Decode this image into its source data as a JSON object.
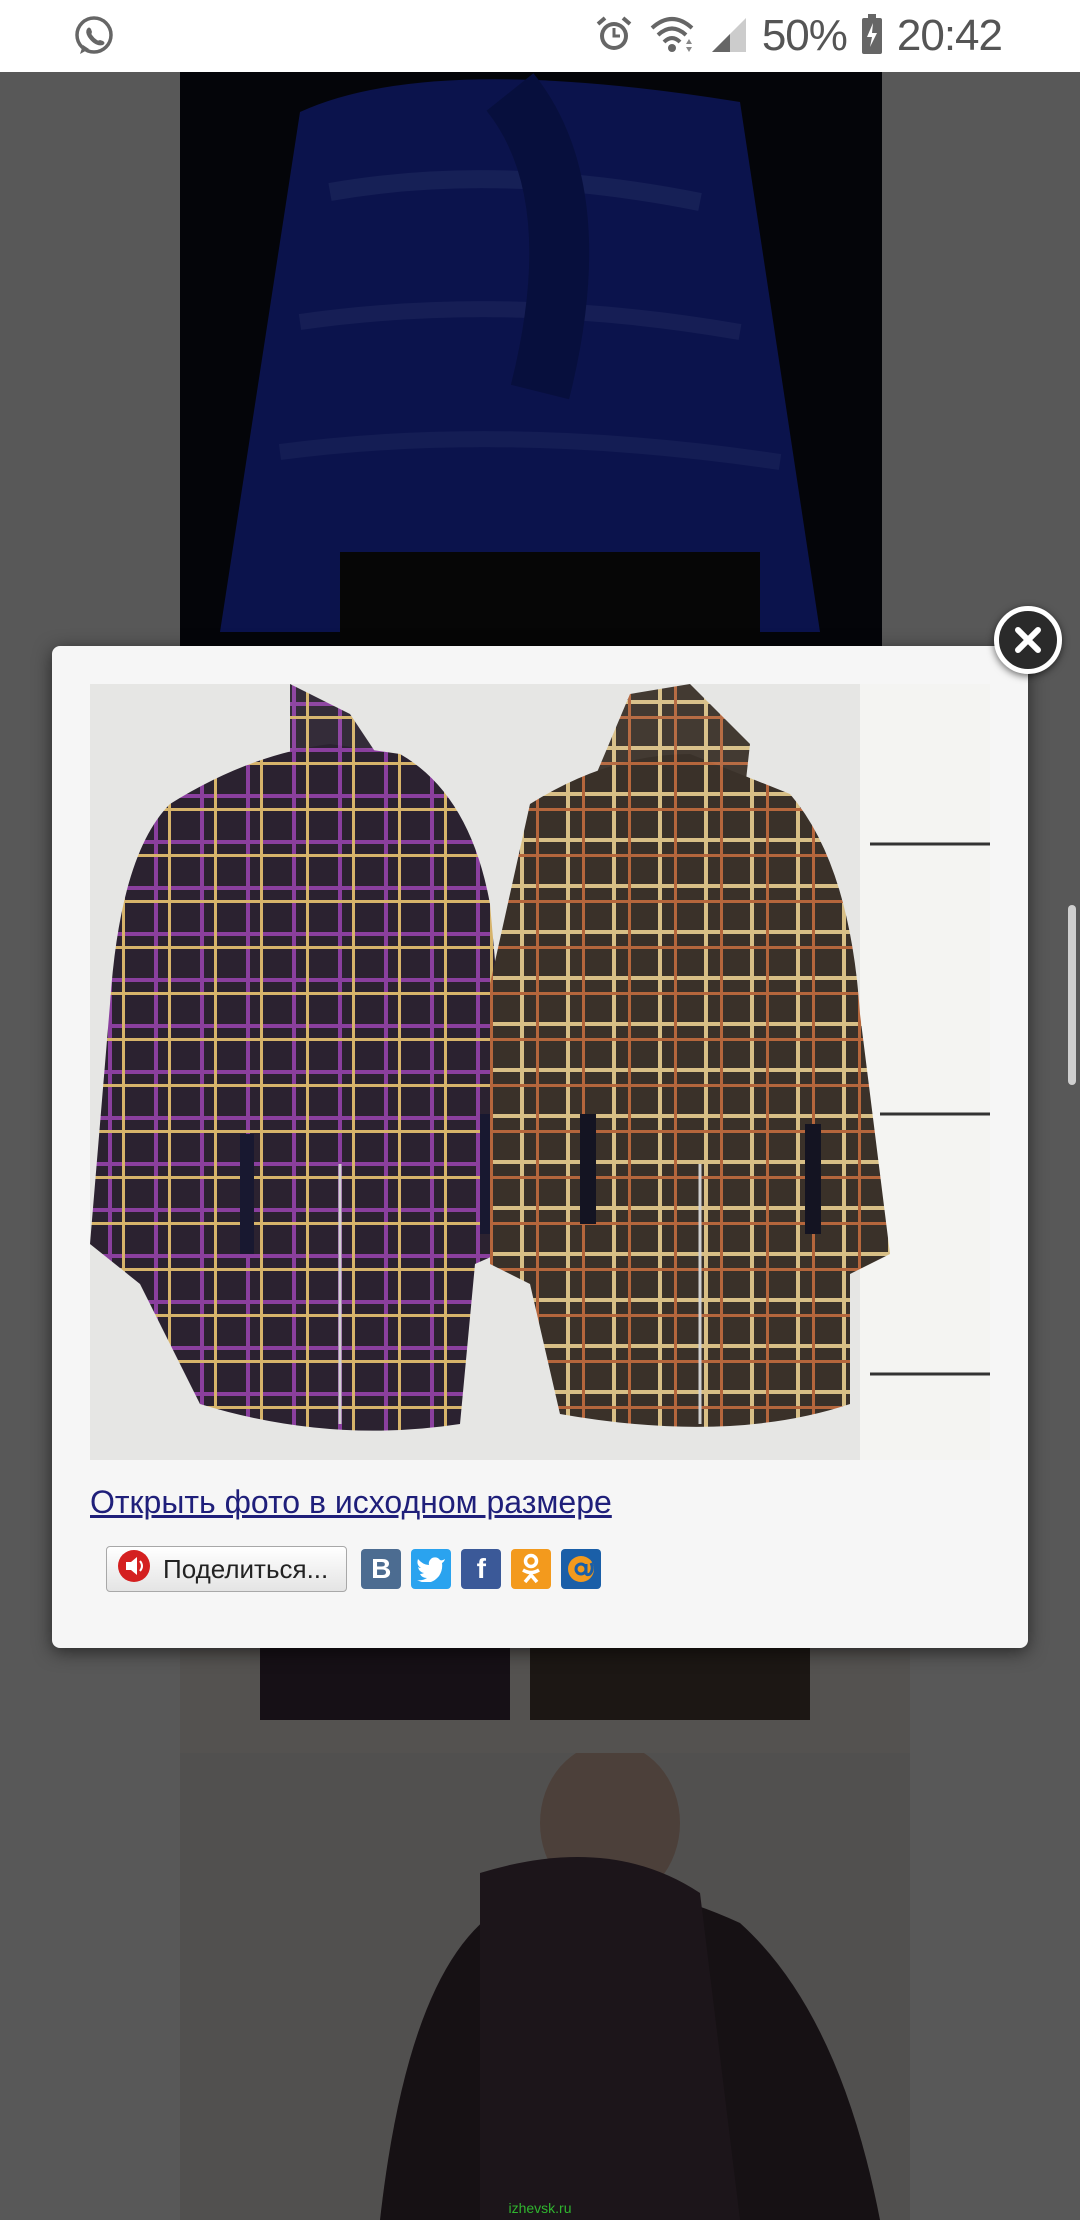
{
  "status_bar": {
    "battery_percent": "50%",
    "time": "20:42",
    "icons": [
      "whatsapp-icon",
      "alarm-icon",
      "wifi-icon",
      "signal-icon",
      "battery-icon"
    ]
  },
  "modal": {
    "open_original_link": "Открыть фото в исходном размере",
    "share_button_label": "Поделиться...",
    "share_services": [
      {
        "name": "vk-icon",
        "glyph": "В",
        "color": "#4c6c91"
      },
      {
        "name": "twitter-icon",
        "glyph": "t",
        "color": "#2aa3ef"
      },
      {
        "name": "facebook-icon",
        "glyph": "f",
        "color": "#3b5998"
      },
      {
        "name": "odnoklassniki-icon",
        "glyph": "ok",
        "color": "#f39a1d"
      },
      {
        "name": "mailru-icon",
        "glyph": "@",
        "color": "#1a5fa8"
      }
    ]
  },
  "footer": {
    "site": "izhevsk.ru"
  },
  "colors": {
    "accent_link": "#1f1f7a",
    "overlay": "#000000"
  }
}
